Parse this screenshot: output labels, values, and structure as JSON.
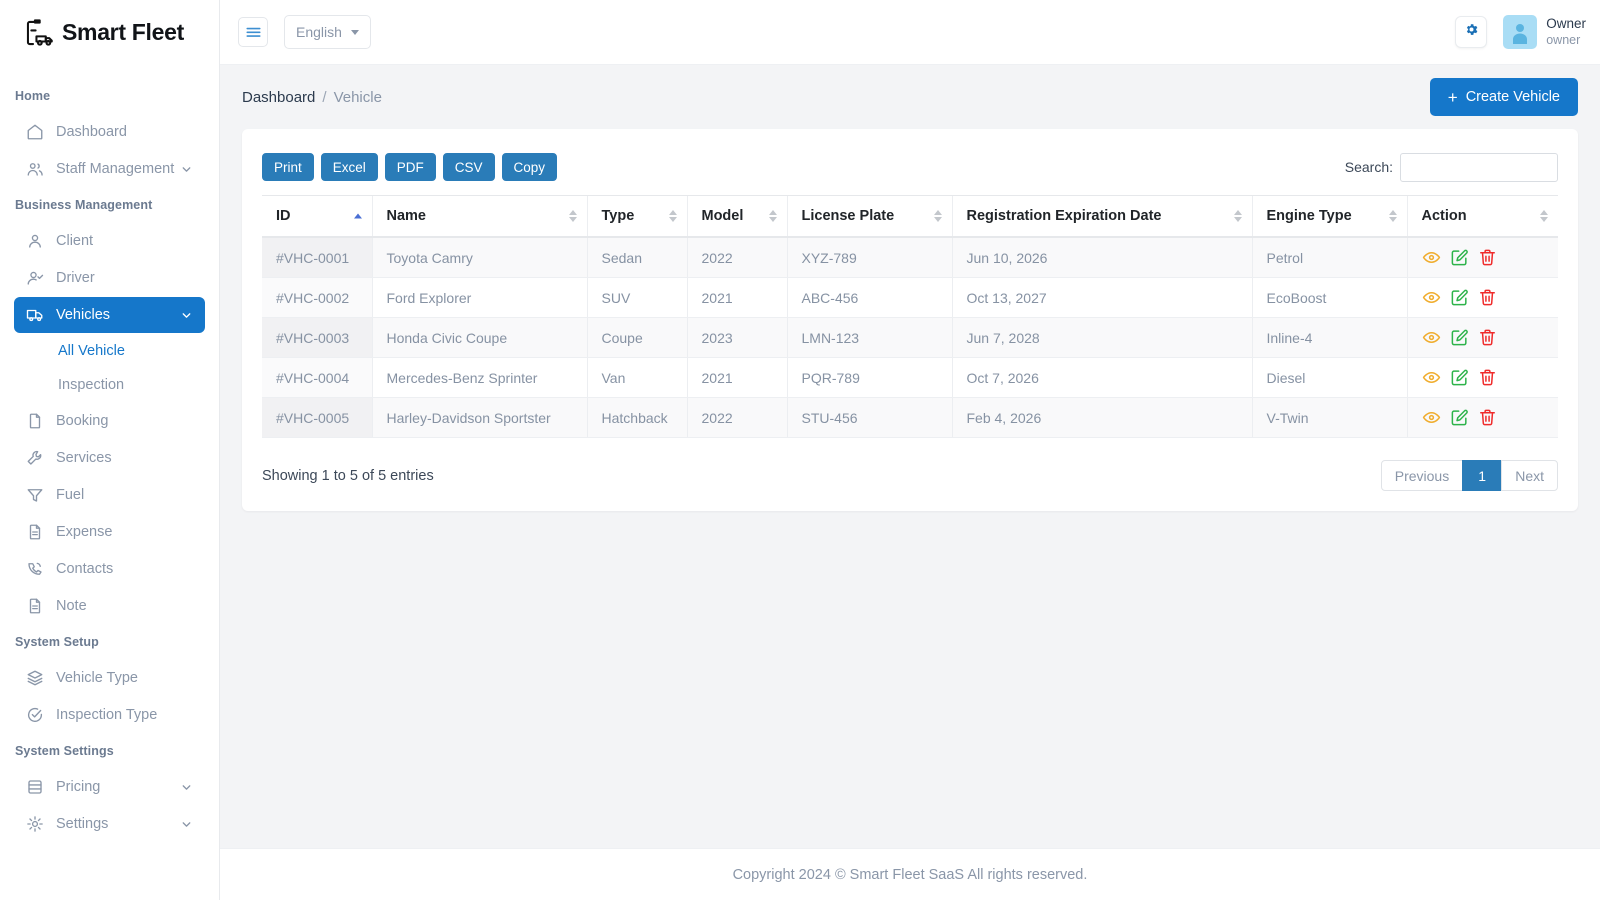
{
  "brand": {
    "name": "Smart Fleet",
    "logo_icon": "clipboard-truck-icon"
  },
  "topbar": {
    "menu_toggle_icon": "hamburger-icon",
    "language": "English",
    "settings_icon": "gear-icon",
    "user": {
      "name": "Owner",
      "role": "owner",
      "avatar_icon": "user-avatar-icon"
    }
  },
  "sidebar": {
    "sections": [
      {
        "label": "Home",
        "items": [
          {
            "label": "Dashboard",
            "icon": "home-icon",
            "expandable": false,
            "active": false
          },
          {
            "label": "Staff Management",
            "icon": "users-icon",
            "expandable": true,
            "active": false
          }
        ]
      },
      {
        "label": "Business Management",
        "items": [
          {
            "label": "Client",
            "icon": "user-icon",
            "expandable": false,
            "active": false
          },
          {
            "label": "Driver",
            "icon": "user-check-icon",
            "expandable": false,
            "active": false
          },
          {
            "label": "Vehicles",
            "icon": "truck-icon",
            "expandable": true,
            "active": true,
            "children": [
              {
                "label": "All Vehicle",
                "current": true
              },
              {
                "label": "Inspection",
                "current": false
              }
            ]
          },
          {
            "label": "Booking",
            "icon": "file-icon",
            "expandable": false,
            "active": false
          },
          {
            "label": "Services",
            "icon": "wrench-icon",
            "expandable": false,
            "active": false
          },
          {
            "label": "Fuel",
            "icon": "funnel-icon",
            "expandable": false,
            "active": false
          },
          {
            "label": "Expense",
            "icon": "file-text-icon",
            "expandable": false,
            "active": false
          },
          {
            "label": "Contacts",
            "icon": "phone-icon",
            "expandable": false,
            "active": false
          },
          {
            "label": "Note",
            "icon": "file-text-icon",
            "expandable": false,
            "active": false
          }
        ]
      },
      {
        "label": "System Setup",
        "items": [
          {
            "label": "Vehicle Type",
            "icon": "layers-icon",
            "expandable": false,
            "active": false
          },
          {
            "label": "Inspection Type",
            "icon": "check-circle-icon",
            "expandable": false,
            "active": false
          }
        ]
      },
      {
        "label": "System Settings",
        "items": [
          {
            "label": "Pricing",
            "icon": "database-icon",
            "expandable": true,
            "active": false
          },
          {
            "label": "Settings",
            "icon": "gear-icon",
            "expandable": true,
            "active": false
          }
        ]
      }
    ]
  },
  "page": {
    "breadcrumb": {
      "root": "Dashboard",
      "separator": "/",
      "current": "Vehicle"
    },
    "create_button": {
      "label": "Create Vehicle",
      "icon": "plus-icon"
    }
  },
  "table_tools": {
    "export_buttons": [
      "Print",
      "Excel",
      "PDF",
      "CSV",
      "Copy"
    ],
    "search_label": "Search:",
    "search_value": "",
    "search_placeholder": ""
  },
  "table": {
    "columns": [
      {
        "label": "ID",
        "sort": "asc"
      },
      {
        "label": "Name",
        "sort": "none"
      },
      {
        "label": "Type",
        "sort": "none"
      },
      {
        "label": "Model",
        "sort": "none"
      },
      {
        "label": "License Plate",
        "sort": "none"
      },
      {
        "label": "Registration Expiration Date",
        "sort": "none"
      },
      {
        "label": "Engine Type",
        "sort": "none"
      },
      {
        "label": "Action",
        "sort": "none"
      }
    ],
    "rows": [
      {
        "id": "#VHC-0001",
        "name": "Toyota Camry",
        "type": "Sedan",
        "model": "2022",
        "plate": "XYZ-789",
        "expiration": "Jun 10, 2026",
        "engine": "Petrol"
      },
      {
        "id": "#VHC-0002",
        "name": "Ford Explorer",
        "type": "SUV",
        "model": "2021",
        "plate": "ABC-456",
        "expiration": "Oct 13, 2027",
        "engine": "EcoBoost"
      },
      {
        "id": "#VHC-0003",
        "name": "Honda Civic Coupe",
        "type": "Coupe",
        "model": "2023",
        "plate": "LMN-123",
        "expiration": "Jun 7, 2028",
        "engine": "Inline-4"
      },
      {
        "id": "#VHC-0004",
        "name": "Mercedes-Benz Sprinter",
        "type": "Van",
        "model": "2021",
        "plate": "PQR-789",
        "expiration": "Oct 7, 2026",
        "engine": "Diesel"
      },
      {
        "id": "#VHC-0005",
        "name": "Harley-Davidson Sportster",
        "type": "Hatchback",
        "model": "2022",
        "plate": "STU-456",
        "expiration": "Feb 4, 2026",
        "engine": "V-Twin"
      }
    ],
    "row_actions": [
      {
        "name": "view-icon",
        "color": "#f0ad2e"
      },
      {
        "name": "edit-icon",
        "color": "#2db34a"
      },
      {
        "name": "delete-icon",
        "color": "#ef2b2b"
      }
    ]
  },
  "pagination": {
    "entries_info": "Showing 1 to 5 of 5 entries",
    "previous": "Previous",
    "pages": [
      "1"
    ],
    "active_page": "1",
    "next": "Next"
  },
  "footer": {
    "text": "Copyright 2024 © Smart Fleet SaaS All rights reserved."
  },
  "colors": {
    "accent": "#1577ca",
    "button_blue": "#2a7cb8",
    "sidebar_text": "#8a96a8",
    "view": "#f0ad2e",
    "edit": "#2db34a",
    "delete": "#ef2b2b"
  }
}
